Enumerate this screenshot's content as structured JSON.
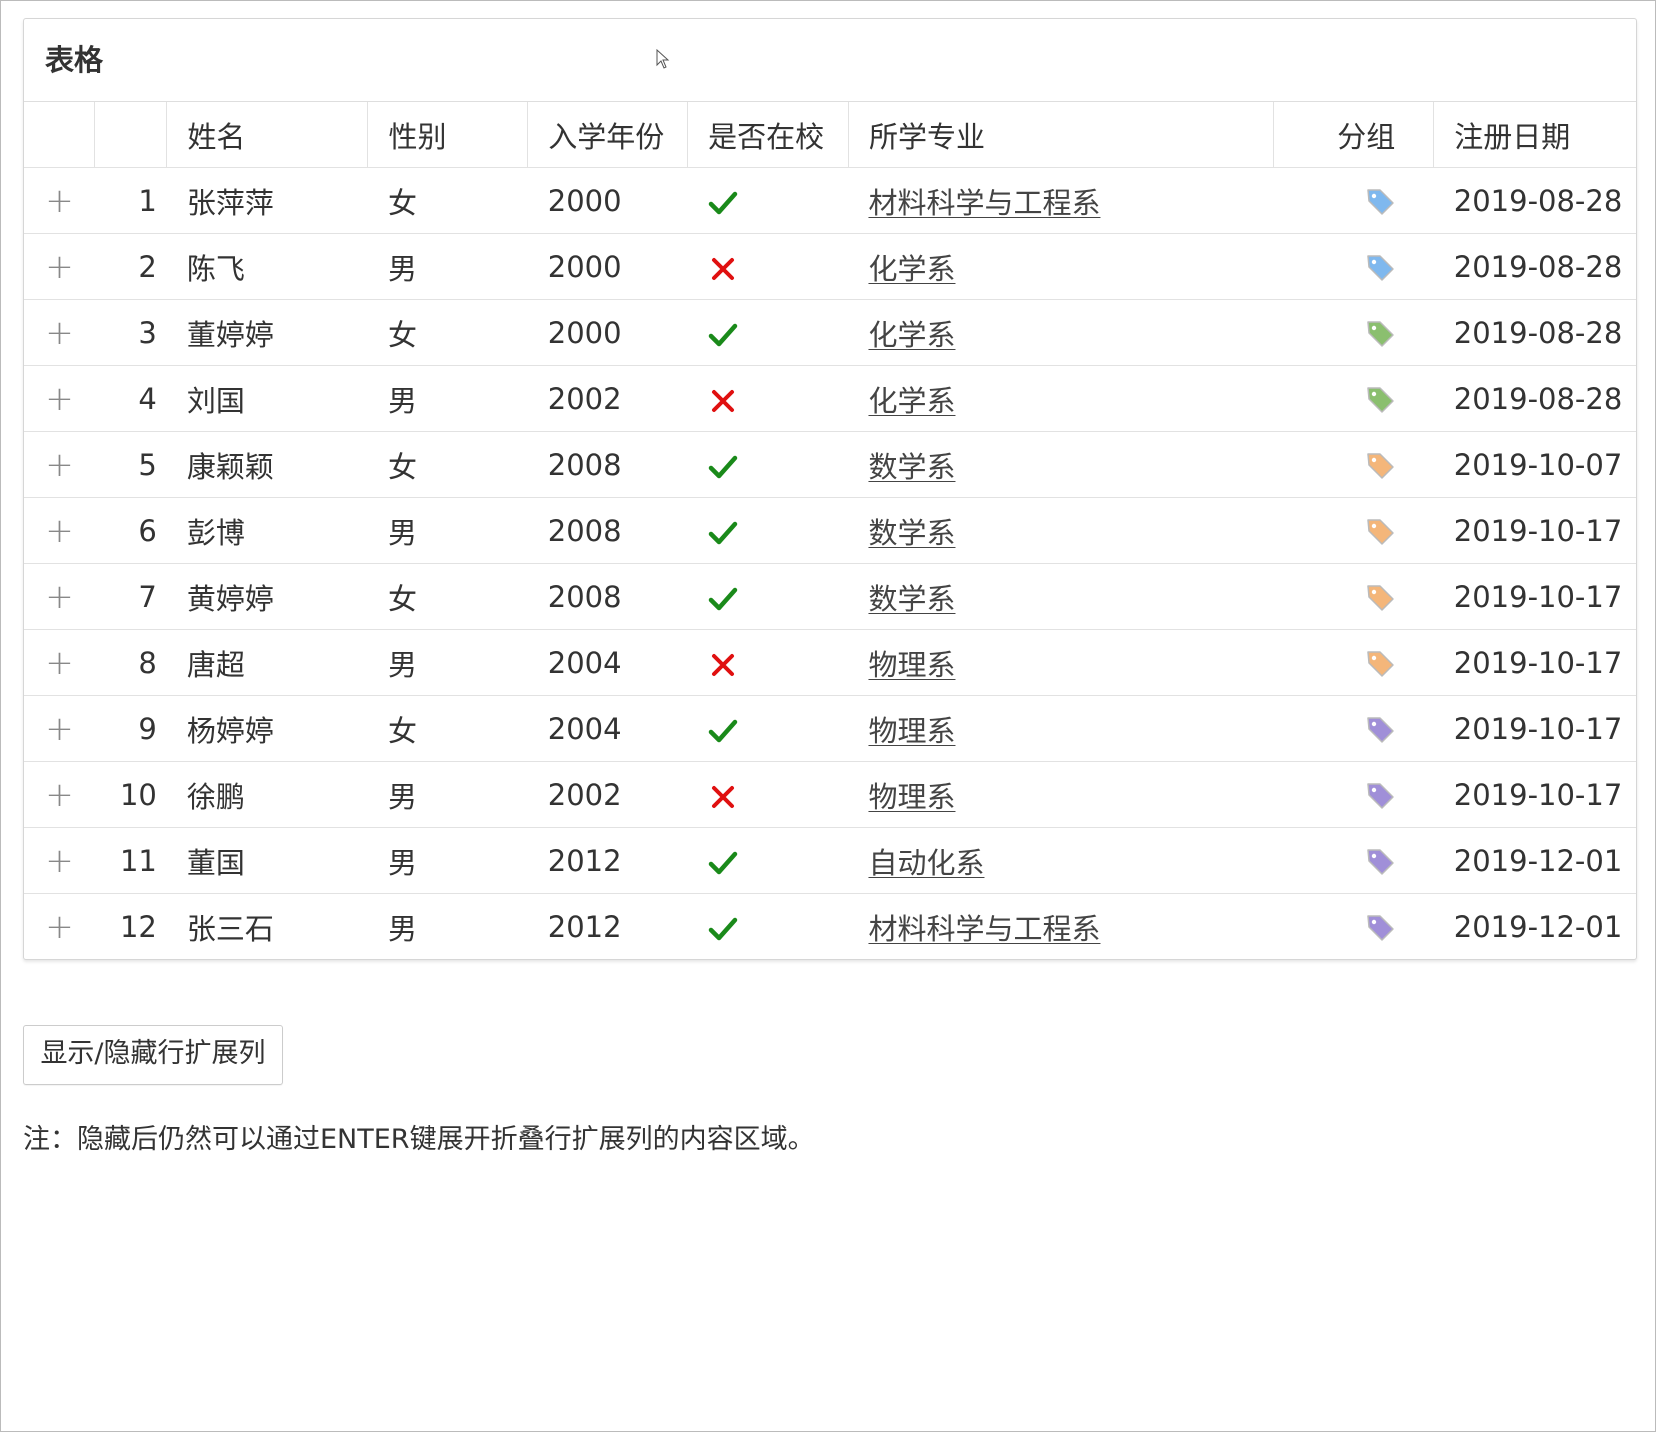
{
  "panel": {
    "title": "表格"
  },
  "columns": {
    "name": "姓名",
    "gender": "性别",
    "year": "入学年份",
    "enrolled": "是否在校",
    "major": "所学专业",
    "group": "分组",
    "date": "注册日期"
  },
  "colors": {
    "check": "#1a8a1a",
    "cross": "#e01010",
    "tag_blue": "#7fb8ee",
    "tag_green": "#8bbf6f",
    "tag_orange": "#f4b67a",
    "tag_purple": "#a08fd8"
  },
  "rows": [
    {
      "idx": "1",
      "name": "张萍萍",
      "gender": "女",
      "year": "2000",
      "enrolled": true,
      "major": "材料科学与工程系",
      "group": "blue",
      "date": "2019-08-28"
    },
    {
      "idx": "2",
      "name": "陈飞",
      "gender": "男",
      "year": "2000",
      "enrolled": false,
      "major": "化学系",
      "group": "blue",
      "date": "2019-08-28"
    },
    {
      "idx": "3",
      "name": "董婷婷",
      "gender": "女",
      "year": "2000",
      "enrolled": true,
      "major": "化学系",
      "group": "green",
      "date": "2019-08-28"
    },
    {
      "idx": "4",
      "name": "刘国",
      "gender": "男",
      "year": "2002",
      "enrolled": false,
      "major": "化学系",
      "group": "green",
      "date": "2019-08-28"
    },
    {
      "idx": "5",
      "name": "康颖颖",
      "gender": "女",
      "year": "2008",
      "enrolled": true,
      "major": "数学系",
      "group": "orange",
      "date": "2019-10-07"
    },
    {
      "idx": "6",
      "name": "彭博",
      "gender": "男",
      "year": "2008",
      "enrolled": true,
      "major": "数学系",
      "group": "orange",
      "date": "2019-10-17"
    },
    {
      "idx": "7",
      "name": "黄婷婷",
      "gender": "女",
      "year": "2008",
      "enrolled": true,
      "major": "数学系",
      "group": "orange",
      "date": "2019-10-17"
    },
    {
      "idx": "8",
      "name": "唐超",
      "gender": "男",
      "year": "2004",
      "enrolled": false,
      "major": "物理系",
      "group": "orange",
      "date": "2019-10-17"
    },
    {
      "idx": "9",
      "name": "杨婷婷",
      "gender": "女",
      "year": "2004",
      "enrolled": true,
      "major": "物理系",
      "group": "purple",
      "date": "2019-10-17"
    },
    {
      "idx": "10",
      "name": "徐鹏",
      "gender": "男",
      "year": "2002",
      "enrolled": false,
      "major": "物理系",
      "group": "purple",
      "date": "2019-10-17"
    },
    {
      "idx": "11",
      "name": "董国",
      "gender": "男",
      "year": "2012",
      "enrolled": true,
      "major": "自动化系",
      "group": "purple",
      "date": "2019-12-01"
    },
    {
      "idx": "12",
      "name": "张三石",
      "gender": "男",
      "year": "2012",
      "enrolled": true,
      "major": "材料科学与工程系",
      "group": "purple",
      "date": "2019-12-01"
    }
  ],
  "expand_symbol": "+",
  "button": {
    "label": "显示/隐藏行扩展列"
  },
  "note": "注：隐藏后仍然可以通过ENTER键展开折叠行扩展列的内容区域。",
  "icons": {
    "expand": "plus-icon",
    "enrolled_true": "check-icon",
    "enrolled_false": "cross-icon",
    "group": "tag-icon"
  }
}
